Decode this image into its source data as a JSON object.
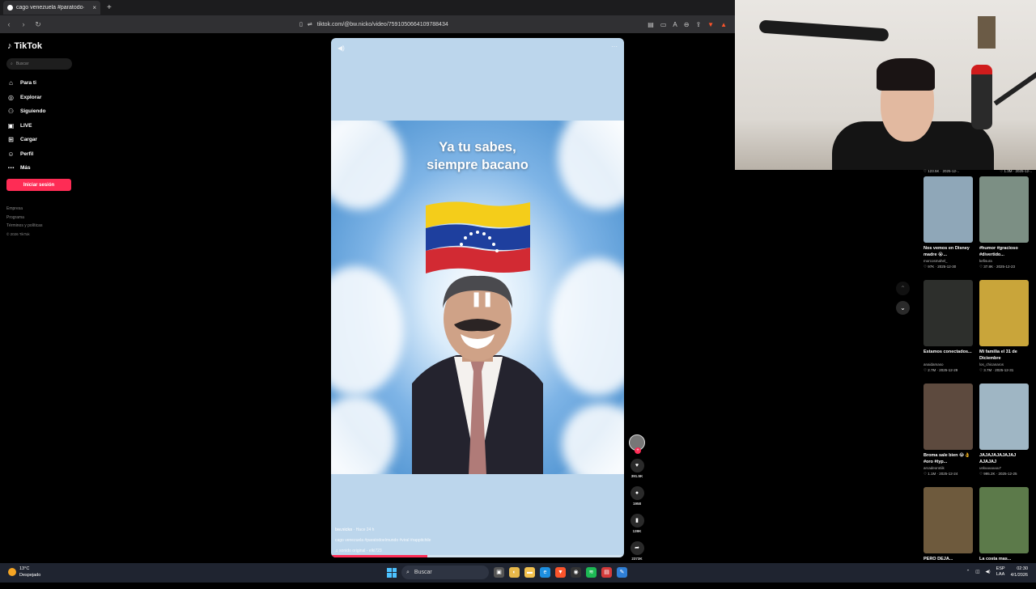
{
  "browser": {
    "tab_title": "cago venezuela #paratodo·",
    "tab_close": "×",
    "new_tab": "+",
    "url": "tiktok.com/@bw.nicko/video/7591050664109788434"
  },
  "sidebar": {
    "logo": "TikTok",
    "search_placeholder": "Buscar",
    "items": [
      {
        "label": "Para ti",
        "icon": "home-icon"
      },
      {
        "label": "Explorar",
        "icon": "compass-icon"
      },
      {
        "label": "Siguiendo",
        "icon": "following-icon"
      },
      {
        "label": "LIVE",
        "icon": "live-icon"
      },
      {
        "label": "Cargar",
        "icon": "upload-icon"
      },
      {
        "label": "Perfil",
        "icon": "profile-icon"
      },
      {
        "label": "Más",
        "icon": "more-icon"
      }
    ],
    "login_label": "Iniciar sesión",
    "footer": [
      "Empresa",
      "Programa",
      "Términos y políticas",
      "© 2026 TikTok"
    ]
  },
  "video": {
    "caption_line1": "Ya tu sabes,",
    "caption_line2": "siempre bacano",
    "author": "bw.nicko",
    "date": "Hace 24 h",
    "description": "cago venezuela #paratodoelmundo #viral #rappitchile",
    "sound": "♫ sonido original - elki723",
    "progress": 0.33
  },
  "actions": {
    "likes": "391.5K",
    "comments": "1958",
    "saves": "139K",
    "shares": "2373K"
  },
  "related": {
    "top_stats": [
      "♡ 123.5K · 2025-12-..",
      "♡ 1.3M · 2025-12-.."
    ],
    "cards": [
      {
        "title": "Nos vemos en Disney madre 😭...",
        "user": "morcosmahel_",
        "stats": "♡ 97K · 2025-12-30",
        "color": "#8fa7b8"
      },
      {
        "title": "#humor #gracioso #divertido...",
        "user": "kefisura",
        "stats": "♡ 37.8K · 2025-12-23",
        "color": "#7c8f84"
      },
      {
        "title": "Estamos conectados...",
        "user": "anaidamaso",
        "stats": "♡ 2.7M · 2025-12-29",
        "color": "#2d2f2c"
      },
      {
        "title": "Mi familia el 31 de Diciembre",
        "user": "los_chicanaros",
        "stats": "♡ 3.7M · 2025-12-31",
        "color": "#c9a53a"
      },
      {
        "title": "Broma sale bien 😂👌 #oro #typ...",
        "user": "arcadeorotiik",
        "stats": "♡ 1.1M · 2025-12-24",
        "color": "#5d4a3e"
      },
      {
        "title": "JAJAJAJAJAJAJ AJAJAJ",
        "user": "uskuuuuuuu7",
        "stats": "♡ 995.2K · 2025-12-25",
        "color": "#9fb6c4"
      },
      {
        "title": "PERO DEJA...",
        "user": "",
        "stats": "",
        "color": "#6e5a3d"
      },
      {
        "title": "La costa mas...",
        "user": "",
        "stats": "",
        "color": "#5c7a4a"
      }
    ]
  },
  "taskbar": {
    "temp": "13°C",
    "weather": "Despejado",
    "search": "Buscar",
    "lang1": "ESP",
    "lang2": "LAA",
    "time": "02:30",
    "date": "4/1/2026"
  }
}
